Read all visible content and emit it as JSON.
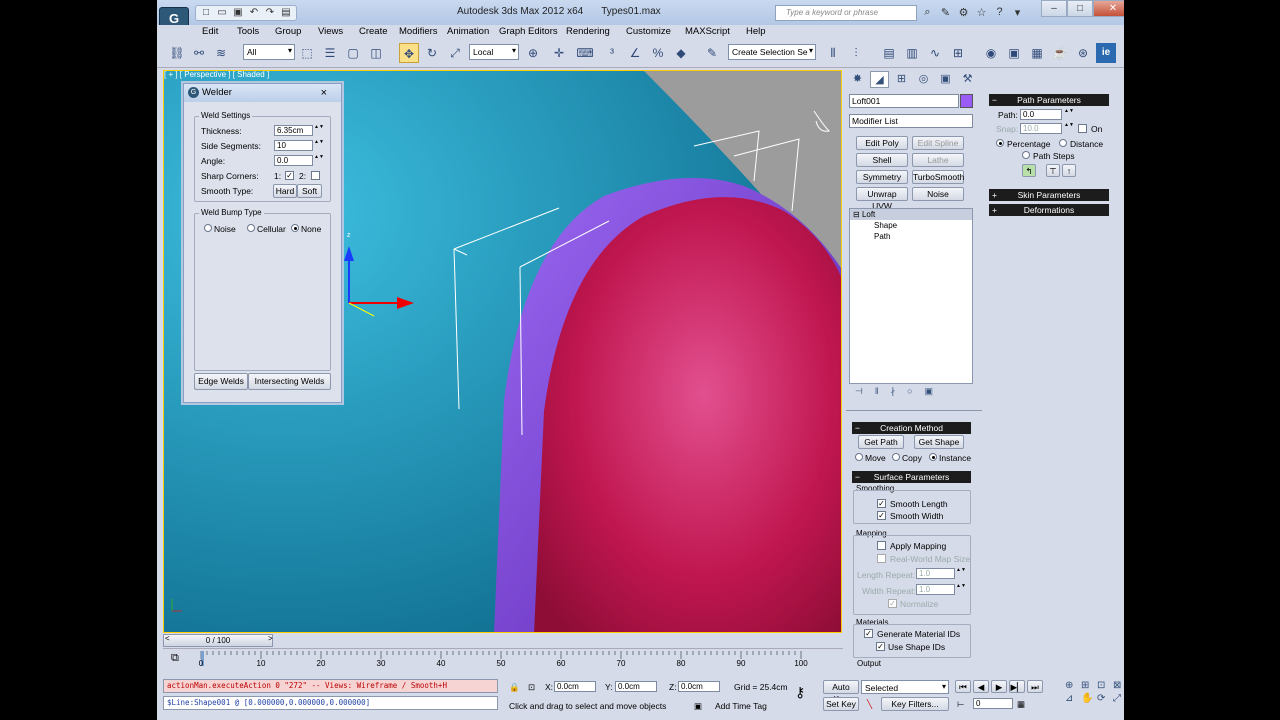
{
  "window": {
    "app_title": "Autodesk 3ds Max  2012 x64",
    "file_name": "Types01.max",
    "search_placeholder": "Type a keyword or phrase"
  },
  "menu": [
    "Edit",
    "Tools",
    "Group",
    "Views",
    "Create",
    "Modifiers",
    "Animation",
    "Graph Editors",
    "Rendering",
    "Customize",
    "MAXScript",
    "Help"
  ],
  "toolbar": {
    "selection_filter": "All",
    "ref_coord": "Local",
    "named_selection": "Create Selection Se"
  },
  "viewport": {
    "label": "[ + ] [ Perspective ] [ Shaded ]",
    "axis_z": "z"
  },
  "welder": {
    "title": "Welder",
    "weld_settings": "Weld Settings",
    "thickness_label": "Thickness:",
    "thickness_value": "6.35cm",
    "side_segments_label": "Side Segments:",
    "side_segments_value": "10",
    "angle_label": "Angle:",
    "angle_value": "0.0",
    "sharp_corners_label": "Sharp Corners:",
    "sharp_1": "1:",
    "sharp_2": "2:",
    "smooth_type_label": "Smooth Type:",
    "hard": "Hard",
    "soft": "Soft",
    "weld_bump_type": "Weld Bump Type",
    "noise": "Noise",
    "cellular": "Cellular",
    "none": "None",
    "edge_welds": "Edge Welds",
    "intersecting_welds": "Intersecting Welds"
  },
  "command_panel": {
    "object_name": "Loft001",
    "object_color": "#9b5bf5",
    "modifier_list": "Modifier List",
    "mod_buttons": [
      "Edit Poly",
      "Edit Spline",
      "Shell",
      "Lathe",
      "Symmetry",
      "TurboSmooth",
      "Unwrap UVW",
      "Noise"
    ],
    "stack": {
      "loft": "Loft",
      "shape": "Shape",
      "path": "Path"
    },
    "creation_method": "Creation Method",
    "get_path": "Get Path",
    "get_shape": "Get Shape",
    "move": "Move",
    "copy": "Copy",
    "instance": "Instance",
    "surface_parameters": "Surface Parameters",
    "smoothing": "Smoothing",
    "smooth_length": "Smooth Length",
    "smooth_width": "Smooth Width",
    "mapping": "Mapping",
    "apply_mapping": "Apply Mapping",
    "real_world": "Real-World Map Size",
    "length_repeat": "Length Repeat:",
    "length_repeat_value": "1.0",
    "width_repeat": "Width Repeat:",
    "width_repeat_value": "1.0",
    "normalize": "Normalize",
    "materials": "Materials",
    "gen_mat_ids": "Generate Material IDs",
    "use_shape_ids": "Use Shape IDs",
    "output": "Output"
  },
  "path_params": {
    "title": "Path Parameters",
    "path_label": "Path:",
    "path_value": "0.0",
    "snap_label": "Snap:",
    "snap_value": "10.0",
    "on": "On",
    "percentage": "Percentage",
    "distance": "Distance",
    "path_steps": "Path Steps",
    "skin_parameters": "Skin Parameters",
    "deformations": "Deformations"
  },
  "timeline": {
    "frame": "0 / 100",
    "ticks": [
      "0",
      "10",
      "20",
      "30",
      "40",
      "50",
      "60",
      "70",
      "80",
      "90",
      "100"
    ]
  },
  "status": {
    "script_line1": "actionMan.executeAction 0 \"272\"  -- Views: Wireframe / Smooth+H",
    "script_line2": "$Line:Shape001 @ [0.000000,0.000000,0.000000]",
    "x_label": "X:",
    "x_value": "0.0cm",
    "y_label": "Y:",
    "y_value": "0.0cm",
    "z_label": "Z:",
    "z_value": "0.0cm",
    "grid": "Grid = 25.4cm",
    "prompt": "Click and drag to select and move objects",
    "add_time_tag": "Add Time Tag",
    "auto_key": "Auto Key",
    "set_key": "Set Key",
    "key_mode": "Selected",
    "key_filters": "Key Filters...",
    "frame_value": "0"
  }
}
